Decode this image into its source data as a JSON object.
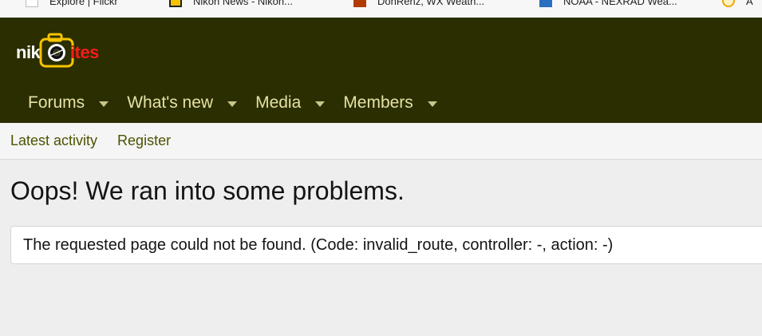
{
  "bookmarks": [
    {
      "label": "Explore | Flickr",
      "icon": "flickr-bookmark-icon"
    },
    {
      "label": "Nikon News - Nikon...",
      "icon": "nikon-bookmark-icon"
    },
    {
      "label": "DonRenz, WX Weath...",
      "icon": "weather-bookmark-icon"
    },
    {
      "label": "NOAA - NEXRAD Wea...",
      "icon": "noaa-bookmark-icon"
    },
    {
      "label": "A",
      "icon": "sun-bookmark-icon"
    }
  ],
  "site": {
    "logo_text_white": "nik",
    "logo_text_red": "ites",
    "brand_bg": "#2b2e00",
    "nav_text_color": "#e5e1a6"
  },
  "nav": {
    "tabs": [
      {
        "label": "Forums"
      },
      {
        "label": "What's new"
      },
      {
        "label": "Media"
      },
      {
        "label": "Members"
      }
    ]
  },
  "subnav": {
    "links": [
      {
        "label": "Latest activity"
      },
      {
        "label": "Register"
      }
    ]
  },
  "error": {
    "title": "Oops! We ran into some problems.",
    "message": "The requested page could not be found. (Code: invalid_route, controller: -, action: -)"
  }
}
